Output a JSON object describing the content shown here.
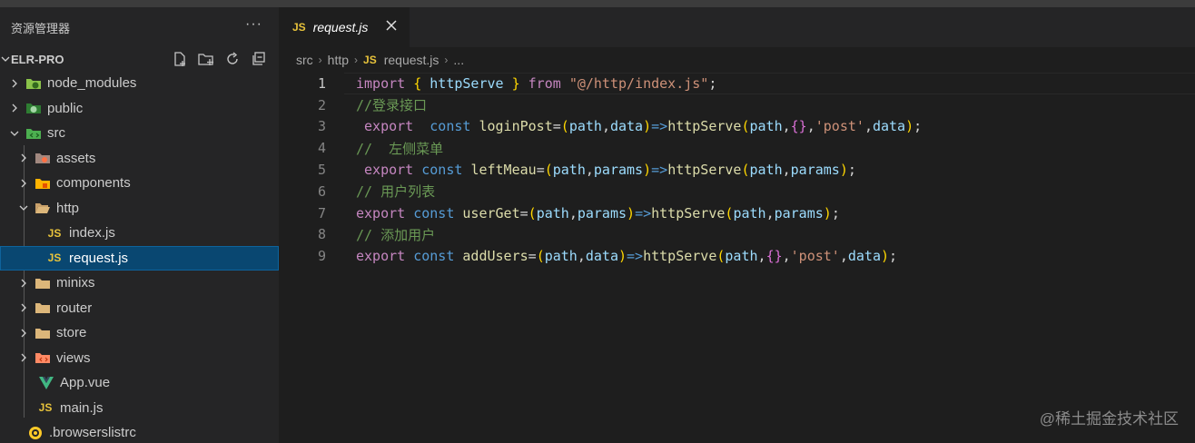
{
  "sidebar": {
    "title": "资源管理器",
    "more": "···",
    "project": "ELR-PRO",
    "items": [
      {
        "label": "node_modules",
        "icon": "node-modules-folder-icon"
      },
      {
        "label": "public",
        "icon": "public-folder-icon"
      },
      {
        "label": "src",
        "icon": "src-folder-icon"
      },
      {
        "label": "assets",
        "icon": "assets-folder-icon"
      },
      {
        "label": "components",
        "icon": "components-folder-icon"
      },
      {
        "label": "http",
        "icon": "open-folder-icon"
      },
      {
        "label": "index.js",
        "icon": "js-file-icon",
        "badge": "JS"
      },
      {
        "label": "request.js",
        "icon": "js-file-icon",
        "badge": "JS"
      },
      {
        "label": "minixs",
        "icon": "folder-icon"
      },
      {
        "label": "router",
        "icon": "folder-icon"
      },
      {
        "label": "store",
        "icon": "folder-icon"
      },
      {
        "label": "views",
        "icon": "views-folder-icon"
      },
      {
        "label": "App.vue",
        "icon": "vue-file-icon"
      },
      {
        "label": "main.js",
        "icon": "js-file-icon",
        "badge": "JS"
      },
      {
        "label": ".browserslistrc",
        "icon": "browserslist-file-icon"
      }
    ]
  },
  "tab": {
    "badge": "JS",
    "label": "request.js"
  },
  "breadcrumb": {
    "parts": [
      "src",
      "http"
    ],
    "file_badge": "JS",
    "file": "request.js",
    "more": "..."
  },
  "editor": {
    "line_numbers": [
      "1",
      "2",
      "3",
      "4",
      "5",
      "6",
      "7",
      "8",
      "9"
    ],
    "lines": [
      [
        [
          "kw",
          "import"
        ],
        [
          "op",
          " "
        ],
        [
          "br1",
          "{"
        ],
        [
          "op",
          " "
        ],
        [
          "var",
          "httpServe"
        ],
        [
          "op",
          " "
        ],
        [
          "br1",
          "}"
        ],
        [
          "op",
          " "
        ],
        [
          "kw",
          "from"
        ],
        [
          "op",
          " "
        ],
        [
          "str",
          "\"@/http/index.js\""
        ],
        [
          "op",
          ";"
        ]
      ],
      [
        [
          "cm",
          "//登录接口"
        ]
      ],
      [
        [
          "op",
          " "
        ],
        [
          "kw",
          "export"
        ],
        [
          "op",
          "  "
        ],
        [
          "kb",
          "const"
        ],
        [
          "op",
          " "
        ],
        [
          "fn",
          "loginPost"
        ],
        [
          "op",
          "="
        ],
        [
          "br1",
          "("
        ],
        [
          "var",
          "path"
        ],
        [
          "op",
          ","
        ],
        [
          "var",
          "data"
        ],
        [
          "br1",
          ")"
        ],
        [
          "kb",
          "=>"
        ],
        [
          "fn",
          "httpServe"
        ],
        [
          "br1",
          "("
        ],
        [
          "var",
          "path"
        ],
        [
          "op",
          ","
        ],
        [
          "br2",
          "{}"
        ],
        [
          "op",
          ","
        ],
        [
          "str",
          "'post'"
        ],
        [
          "op",
          ","
        ],
        [
          "var",
          "data"
        ],
        [
          "br1",
          ")"
        ],
        [
          "op",
          ";"
        ]
      ],
      [
        [
          "cm",
          "//  左侧菜单"
        ]
      ],
      [
        [
          "op",
          " "
        ],
        [
          "kw",
          "export"
        ],
        [
          "op",
          " "
        ],
        [
          "kb",
          "const"
        ],
        [
          "op",
          " "
        ],
        [
          "fn",
          "leftMeau"
        ],
        [
          "op",
          "="
        ],
        [
          "br1",
          "("
        ],
        [
          "var",
          "path"
        ],
        [
          "op",
          ","
        ],
        [
          "var",
          "params"
        ],
        [
          "br1",
          ")"
        ],
        [
          "kb",
          "=>"
        ],
        [
          "fn",
          "httpServe"
        ],
        [
          "br1",
          "("
        ],
        [
          "var",
          "path"
        ],
        [
          "op",
          ","
        ],
        [
          "var",
          "params"
        ],
        [
          "br1",
          ")"
        ],
        [
          "op",
          ";"
        ]
      ],
      [
        [
          "cm",
          "// 用户列表"
        ]
      ],
      [
        [
          "kw",
          "export"
        ],
        [
          "op",
          " "
        ],
        [
          "kb",
          "const"
        ],
        [
          "op",
          " "
        ],
        [
          "fn",
          "userGet"
        ],
        [
          "op",
          "="
        ],
        [
          "br1",
          "("
        ],
        [
          "var",
          "path"
        ],
        [
          "op",
          ","
        ],
        [
          "var",
          "params"
        ],
        [
          "br1",
          ")"
        ],
        [
          "kb",
          "=>"
        ],
        [
          "fn",
          "httpServe"
        ],
        [
          "br1",
          "("
        ],
        [
          "var",
          "path"
        ],
        [
          "op",
          ","
        ],
        [
          "var",
          "params"
        ],
        [
          "br1",
          ")"
        ],
        [
          "op",
          ";"
        ]
      ],
      [
        [
          "cm",
          "// 添加用户"
        ]
      ],
      [
        [
          "kw",
          "export"
        ],
        [
          "op",
          " "
        ],
        [
          "kb",
          "const"
        ],
        [
          "op",
          " "
        ],
        [
          "fn",
          "addUsers"
        ],
        [
          "op",
          "="
        ],
        [
          "br1",
          "("
        ],
        [
          "var",
          "path"
        ],
        [
          "op",
          ","
        ],
        [
          "var",
          "data"
        ],
        [
          "br1",
          ")"
        ],
        [
          "kb",
          "=>"
        ],
        [
          "fn",
          "httpServe"
        ],
        [
          "br1",
          "("
        ],
        [
          "var",
          "path"
        ],
        [
          "op",
          ","
        ],
        [
          "br2",
          "{}"
        ],
        [
          "op",
          ","
        ],
        [
          "str",
          "'post'"
        ],
        [
          "op",
          ","
        ],
        [
          "var",
          "data"
        ],
        [
          "br1",
          ")"
        ],
        [
          "op",
          ";"
        ]
      ]
    ]
  },
  "watermark": "@稀土掘金技术社区"
}
